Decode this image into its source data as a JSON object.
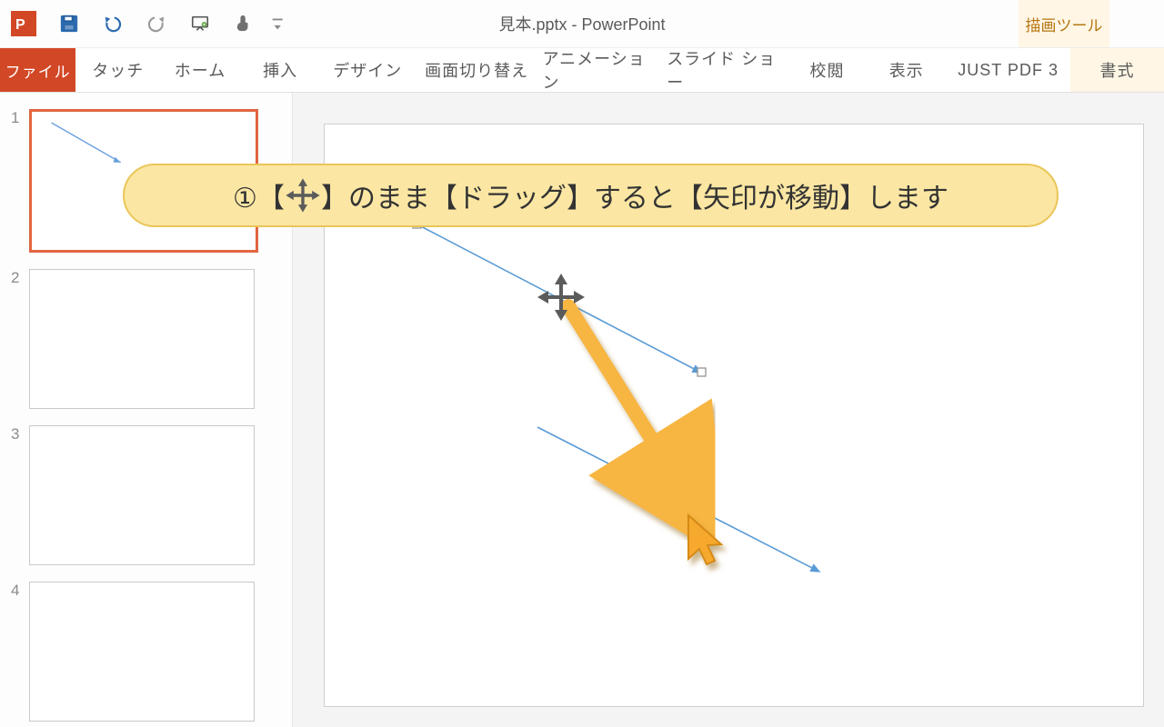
{
  "window_title": "見本.pptx - PowerPoint",
  "context_tab": "描画ツール",
  "ribbon": {
    "file": "ファイル",
    "tabs": [
      "タッチ",
      "ホーム",
      "挿入",
      "デザイン",
      "画面切り替え",
      "アニメーション",
      "スライド ショー",
      "校閲",
      "表示",
      "JUST PDF 3",
      "書式"
    ]
  },
  "thumbs": [
    "1",
    "2",
    "3",
    "4"
  ],
  "callout": {
    "pre": "①【",
    "post": "】のまま【ドラッグ】すると【矢印が移動】します"
  }
}
